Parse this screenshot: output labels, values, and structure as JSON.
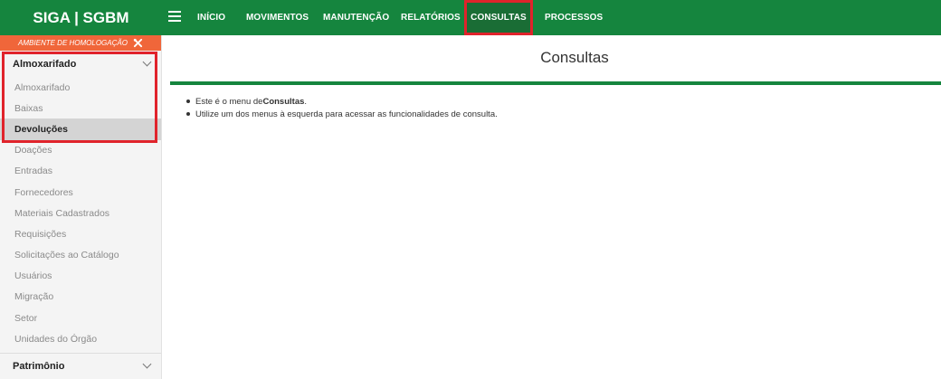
{
  "app": {
    "brand": "SIGA | SGBM"
  },
  "nav": [
    {
      "label": "INÍCIO",
      "active": false
    },
    {
      "label": "MOVIMENTOS",
      "active": false
    },
    {
      "label": "MANUTENÇÃO",
      "active": false
    },
    {
      "label": "RELATÓRIOS",
      "active": false
    },
    {
      "label": "CONSULTAS",
      "active": true
    },
    {
      "label": "PROCESSOS",
      "active": false
    }
  ],
  "sidebar": {
    "env_banner": "AMBIENTE DE HOMOLOGAÇÃO",
    "section": "Almoxarifado",
    "items": [
      "Almoxarifado",
      "Baixas",
      "Devoluções",
      "Doações",
      "Entradas",
      "Fornecedores",
      "Materiais Cadastrados",
      "Requisições",
      "Solicitações ao Catálogo",
      "Usuários",
      "Migração",
      "Setor",
      "Unidades do Órgão"
    ],
    "selected_index": 2,
    "footer_section": "Patrimônio"
  },
  "main": {
    "title": "Consultas",
    "line1_pre": "Este é o menu de ",
    "line1_bold": "Consultas",
    "line1_post": ".",
    "line2": "Utilize um dos menus à esquerda para acessar as funcionalidades de consulta."
  },
  "colors": {
    "primary": "#15853e",
    "banner": "#f0663a",
    "highlight": "#e0232b"
  }
}
